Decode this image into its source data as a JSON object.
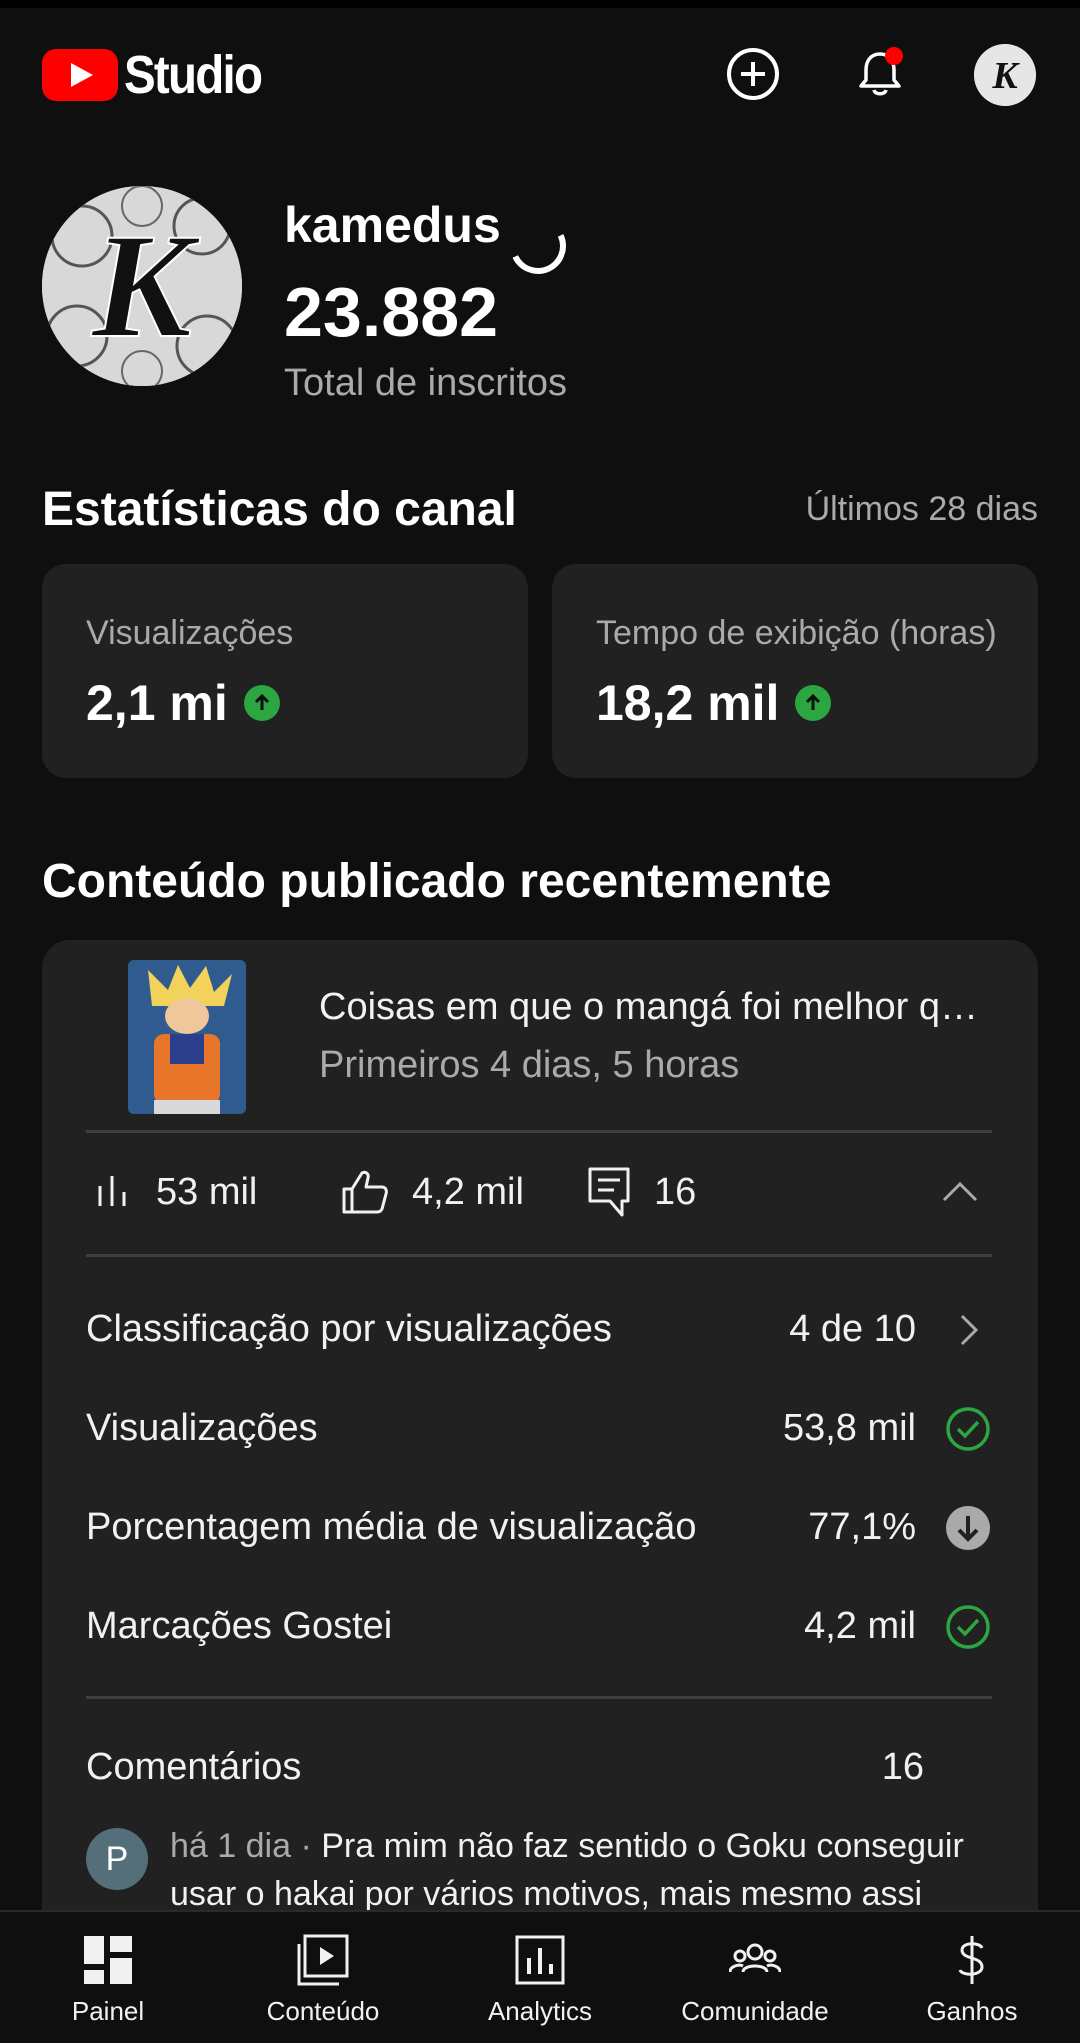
{
  "header": {
    "logo_text": "Studio"
  },
  "channel": {
    "name": "kamedus",
    "subscriber_count": "23.882",
    "subscriber_label": "Total de inscritos",
    "avatar_letter": "K"
  },
  "stats": {
    "title": "Estatísticas do canal",
    "period": "Últimos 28 dias",
    "cards": [
      {
        "label": "Visualizações",
        "value": "2,1 mi",
        "trend": "up"
      },
      {
        "label": "Tempo de exibição (horas)",
        "value": "18,2 mil",
        "trend": "up"
      }
    ]
  },
  "recent": {
    "title": "Conteúdo publicado recentemente",
    "video": {
      "title": "Coisas em que o mangá foi melhor que o anime",
      "subtitle": "Primeiros 4 dias, 5 horas",
      "views": "53 mil",
      "likes": "4,2 mil",
      "comments": "16"
    },
    "details": [
      {
        "label": "Classificação por visualizações",
        "value": "4 de 10",
        "icon": "chevron-right-icon"
      },
      {
        "label": "Visualizações",
        "value": "53,8 mil",
        "icon": "check-circle-icon"
      },
      {
        "label": "Porcentagem média de visualização",
        "value": "77,1%",
        "icon": "arrow-down-circle-icon"
      },
      {
        "label": "Marcações Gostei",
        "value": "4,2 mil",
        "icon": "check-circle-icon"
      }
    ],
    "comments_label": "Comentários",
    "comments_count": "16",
    "comment": {
      "avatar_letter": "P",
      "meta": "há 1 dia · ",
      "text": "Pra mim não faz sentido o Goku conseguir usar o hakai por vários motivos, mais mesmo assi"
    }
  },
  "nav": [
    {
      "label": "Painel",
      "icon": "dashboard-icon"
    },
    {
      "label": "Conteúdo",
      "icon": "content-icon"
    },
    {
      "label": "Analytics",
      "icon": "analytics-icon"
    },
    {
      "label": "Comunidade",
      "icon": "community-icon"
    },
    {
      "label": "Ganhos",
      "icon": "dollar-icon"
    }
  ],
  "colors": {
    "accent_red": "#ff0000",
    "positive_green": "#2ba640",
    "background": "#0f0f0f",
    "card": "#212121"
  }
}
